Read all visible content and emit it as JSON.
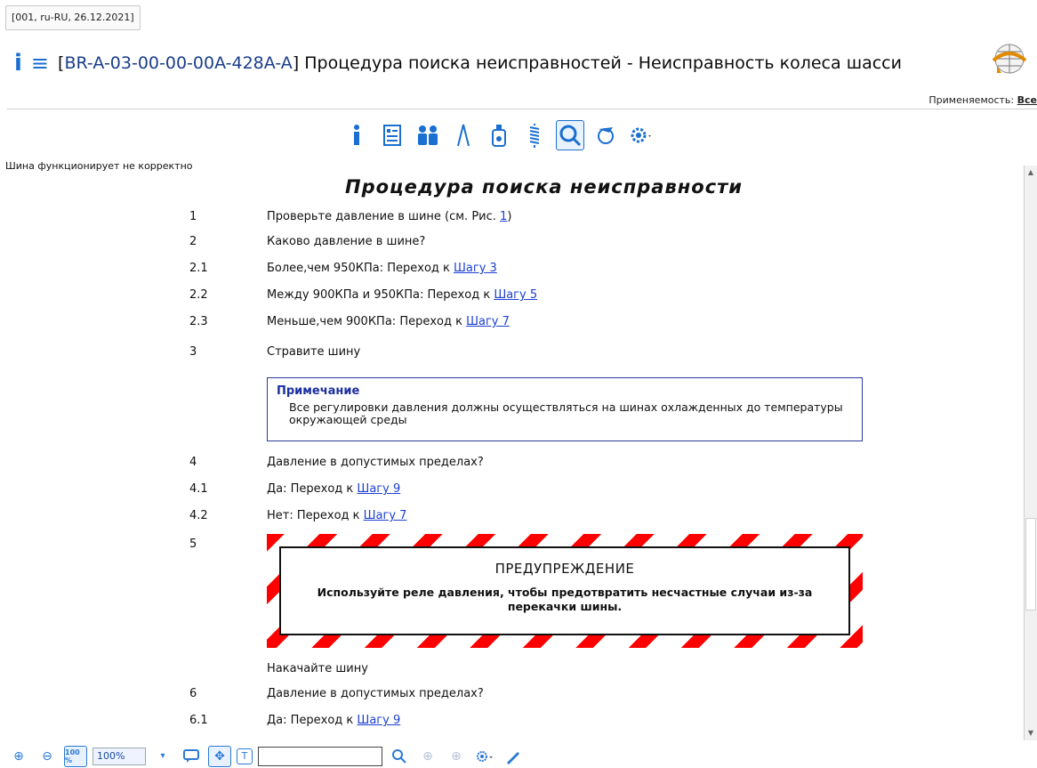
{
  "meta": {
    "context": "[001, ru-RU, 26.12.2021]"
  },
  "header": {
    "code": "BR-A-03-00-00-00A-428A-A",
    "title": "Процедура поиска неисправностей - Неисправность колеса шасси"
  },
  "applicability": {
    "label": "Применяемость:",
    "value": "Все"
  },
  "left_note": "Шина функционирует не корректно",
  "procedure": {
    "title": "Процедура поиска неисправности",
    "steps": [
      {
        "num": "1",
        "text": "Проверьте давление в шине (см. Рис. ",
        "link": "1",
        "suffix": ")"
      },
      {
        "num": "2",
        "text": "Каково давление в шине?"
      },
      {
        "num": "2.1",
        "text": "Более,чем 950КПа: Переход к ",
        "link": "Шагу 3"
      },
      {
        "num": "2.2",
        "text": "Между 900КПа и 950КПа: Переход к ",
        "link": "Шагу 5"
      },
      {
        "num": "2.3",
        "text": "Меньше,чем 900КПа: Переход к ",
        "link": "Шагу 7"
      },
      {
        "num": "3",
        "text": "Стравите шину"
      },
      {
        "num": "4",
        "text": "Давление в допустимых пределах?"
      },
      {
        "num": "4.1",
        "text": "Да: Переход к ",
        "link": "Шагу 9"
      },
      {
        "num": "4.2",
        "text": "Нет: Переход к ",
        "link": "Шагу 7"
      },
      {
        "num": "5",
        "text": ""
      },
      {
        "num": "",
        "text": "Накачайте шину"
      },
      {
        "num": "6",
        "text": "Давление в допустимых пределах?"
      },
      {
        "num": "6.1",
        "text": "Да: Переход к ",
        "link": "Шагу 9"
      }
    ],
    "note": {
      "title": "Примечание",
      "text": "Все регулировки давления должны осуществляться на шинах охлажденных до температуры окружающей среды"
    },
    "warning": {
      "title": "ПРЕДУПРЕЖДЕНИЕ",
      "text": "Используйте реле давления, чтобы предотвратить несчастные случаи из-за перекачки шины."
    }
  },
  "toolbar": {
    "icons": [
      "info-icon",
      "document-list-icon",
      "people-icon",
      "tools-icon",
      "bottle-icon",
      "spring-icon",
      "search-zoom-icon",
      "satellite-icon",
      "settings-icon"
    ]
  },
  "bottom": {
    "zoom_value": "100%",
    "zoom_badge": "100 %"
  },
  "colors": {
    "accent": "#1a6fd0",
    "link": "#1b3fd3",
    "note_border": "#2b3aa0",
    "warning_stripe": "#ff0000"
  }
}
